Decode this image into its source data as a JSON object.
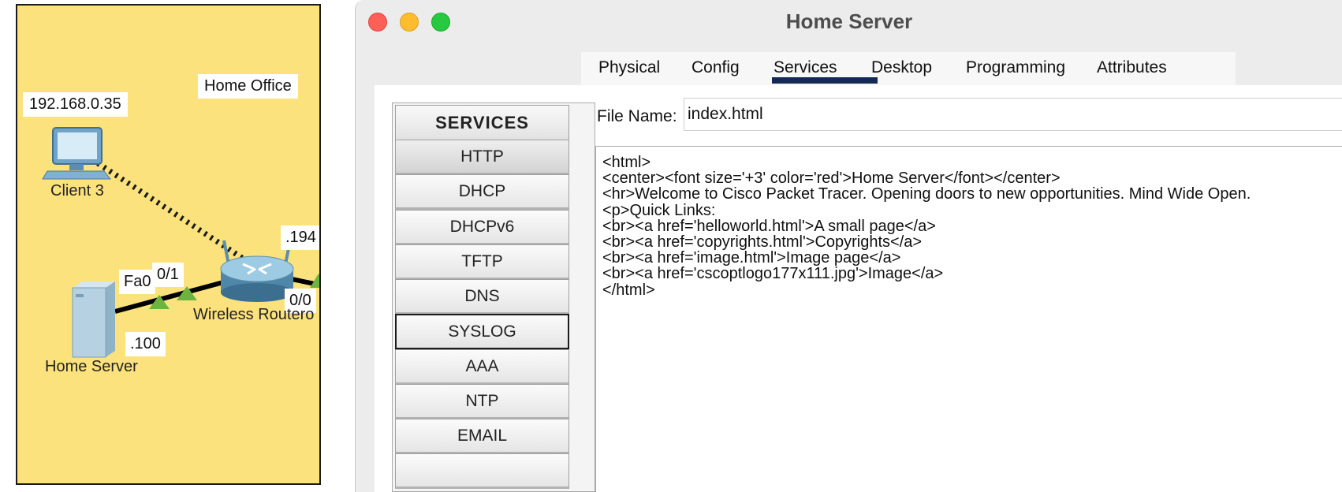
{
  "topology": {
    "area_label": "Home Office",
    "client": {
      "ip_label": "192.168.0.35",
      "name": "Client 3"
    },
    "server": {
      "name": "Home Server",
      "ip_suffix": ".100"
    },
    "router": {
      "name": "Wireless Routero",
      "wan_ip_suffix": ".194"
    },
    "ports": {
      "server_port": "Fa0",
      "router_lan_port": "0/1",
      "router_wan_port": "0/0"
    },
    "colors": {
      "background": "#fce27d",
      "link_up": "#6db33f"
    }
  },
  "window": {
    "title": "Home Server",
    "tabs": [
      {
        "label": "Physical"
      },
      {
        "label": "Config"
      },
      {
        "label": "Services",
        "selected": true
      },
      {
        "label": "Desktop"
      },
      {
        "label": "Programming"
      },
      {
        "label": "Attributes"
      }
    ]
  },
  "services": {
    "header": "SERVICES",
    "selected": "HTTP",
    "items": [
      {
        "label": "HTTP"
      },
      {
        "label": "DHCP"
      },
      {
        "label": "DHCPv6"
      },
      {
        "label": "TFTP"
      },
      {
        "label": "DNS"
      },
      {
        "label": "SYSLOG"
      },
      {
        "label": "AAA"
      },
      {
        "label": "NTP"
      },
      {
        "label": "EMAIL"
      }
    ]
  },
  "editor": {
    "file_name_label": "File Name:",
    "file_name_value": "index.html",
    "content": "<html>\n<center><font size='+3' color='red'>Home Server</font></center>\n<hr>Welcome to Cisco Packet Tracer. Opening doors to new opportunities. Mind Wide Open.\n<p>Quick Links:\n<br><a href='helloworld.html'>A small page</a>\n<br><a href='copyrights.html'>Copyrights</a>\n<br><a href='image.html'>Image page</a>\n<br><a href='cscoptlogo177x111.jpg'>Image</a>\n</html>"
  }
}
